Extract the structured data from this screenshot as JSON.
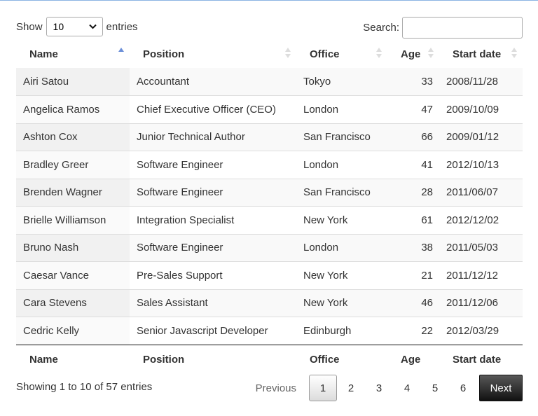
{
  "length": {
    "show_label": "Show",
    "selected": "10",
    "entries_label": "entries"
  },
  "search": {
    "label": "Search:",
    "value": ""
  },
  "columns": [
    "Name",
    "Position",
    "Office",
    "Age",
    "Start date"
  ],
  "rows": [
    [
      "Airi Satou",
      "Accountant",
      "Tokyo",
      "33",
      "2008/11/28"
    ],
    [
      "Angelica Ramos",
      "Chief Executive Officer (CEO)",
      "London",
      "47",
      "2009/10/09"
    ],
    [
      "Ashton Cox",
      "Junior Technical Author",
      "San Francisco",
      "66",
      "2009/01/12"
    ],
    [
      "Bradley Greer",
      "Software Engineer",
      "London",
      "41",
      "2012/10/13"
    ],
    [
      "Brenden Wagner",
      "Software Engineer",
      "San Francisco",
      "28",
      "2011/06/07"
    ],
    [
      "Brielle Williamson",
      "Integration Specialist",
      "New York",
      "61",
      "2012/12/02"
    ],
    [
      "Bruno Nash",
      "Software Engineer",
      "London",
      "38",
      "2011/05/03"
    ],
    [
      "Caesar Vance",
      "Pre-Sales Support",
      "New York",
      "21",
      "2011/12/12"
    ],
    [
      "Cara Stevens",
      "Sales Assistant",
      "New York",
      "46",
      "2011/12/06"
    ],
    [
      "Cedric Kelly",
      "Senior Javascript Developer",
      "Edinburgh",
      "22",
      "2012/03/29"
    ]
  ],
  "info": "Showing 1 to 10 of 57 entries",
  "pagination": {
    "previous": "Previous",
    "pages": [
      "1",
      "2",
      "3",
      "4",
      "5",
      "6"
    ],
    "current": "1",
    "next": "Next"
  },
  "colors": {
    "sort_active": "#6b8fd8",
    "sort_inactive": "#dddddd",
    "next_bg": "#111111"
  }
}
